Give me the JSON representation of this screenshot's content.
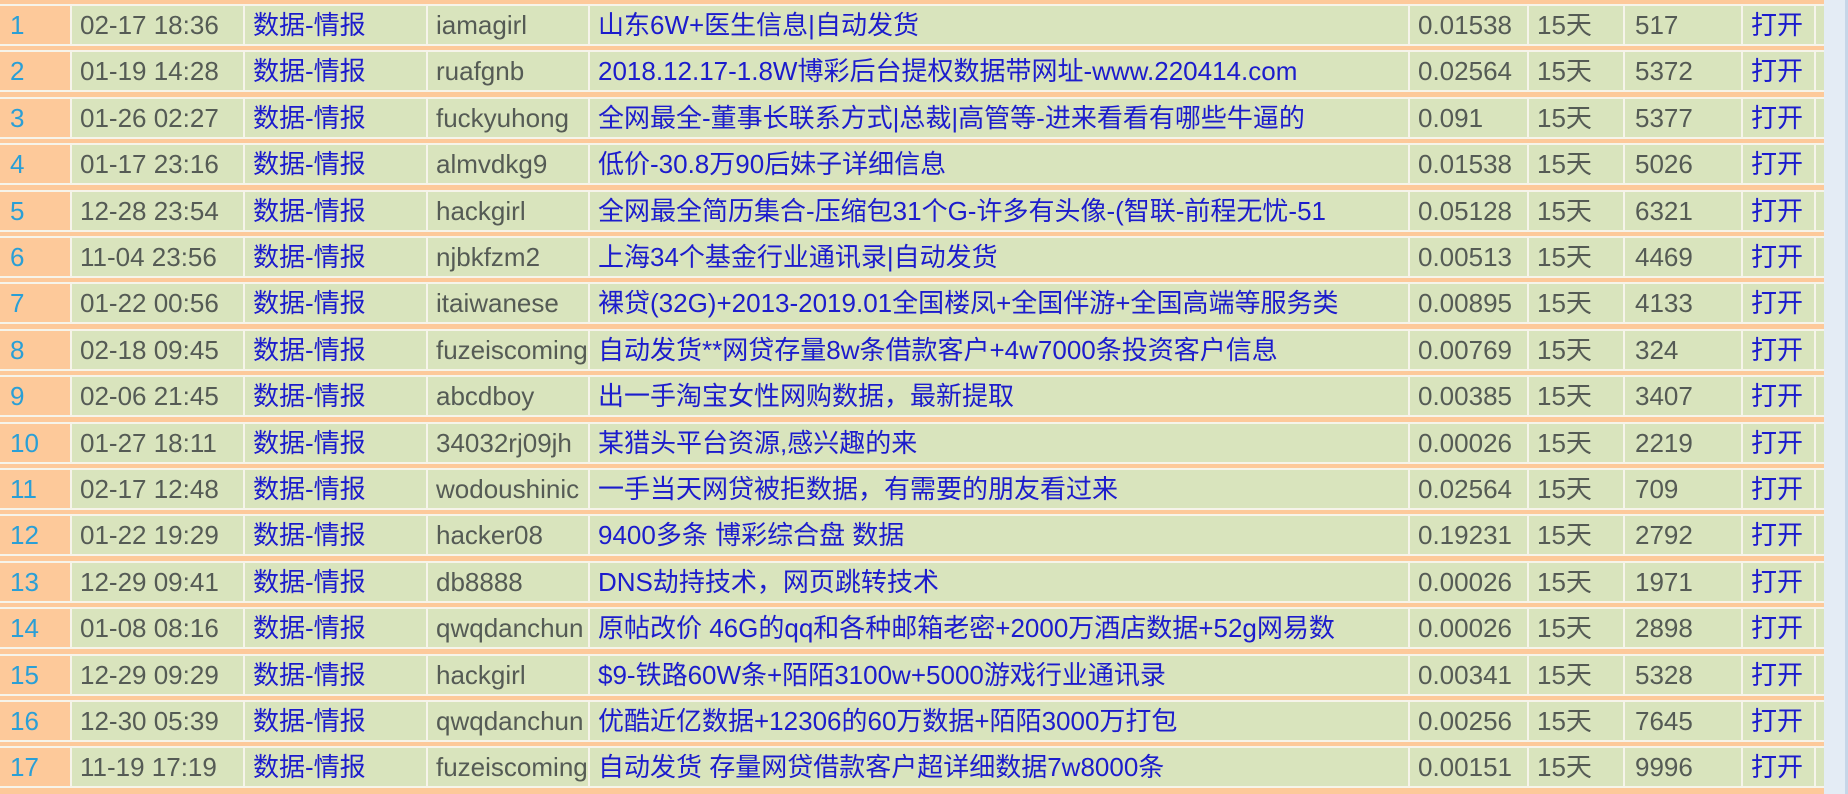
{
  "colors": {
    "row_separator": "#fdc99a",
    "cell_bg": "#d9e4bd",
    "index_bg": "#fdc99a",
    "index_text": "#2a9fd6",
    "link_text": "#1c1ccc",
    "plain_text": "#555b55",
    "page_bg": "#e4ecf5"
  },
  "rows": [
    {
      "index": "1",
      "date": "02-17 18:36",
      "category": "数据-情报",
      "user": "iamagirl",
      "title": "山东6W+医生信息|自动发货",
      "price": "0.01538",
      "days": "15天",
      "views": "517",
      "action": "打开"
    },
    {
      "index": "2",
      "date": "01-19 14:28",
      "category": "数据-情报",
      "user": "ruafgnb",
      "title": "2018.12.17-1.8W博彩后台提权数据带网址-www.220414.com",
      "price": "0.02564",
      "days": "15天",
      "views": "5372",
      "action": "打开"
    },
    {
      "index": "3",
      "date": "01-26 02:27",
      "category": "数据-情报",
      "user": "fuckyuhong",
      "title": "全网最全-董事长联系方式|总裁|高管等-进来看看有哪些牛逼的",
      "price": "0.091",
      "days": "15天",
      "views": "5377",
      "action": "打开"
    },
    {
      "index": "4",
      "date": "01-17 23:16",
      "category": "数据-情报",
      "user": "almvdkg9",
      "title": "低价-30.8万90后妹子详细信息",
      "price": "0.01538",
      "days": "15天",
      "views": "5026",
      "action": "打开"
    },
    {
      "index": "5",
      "date": "12-28 23:54",
      "category": "数据-情报",
      "user": "hackgirl",
      "title": "全网最全简历集合-压缩包31个G-许多有头像-(智联-前程无忧-51",
      "price": "0.05128",
      "days": "15天",
      "views": "6321",
      "action": "打开"
    },
    {
      "index": "6",
      "date": "11-04 23:56",
      "category": "数据-情报",
      "user": "njbkfzm2",
      "title": "上海34个基金行业通讯录|自动发货",
      "price": "0.00513",
      "days": "15天",
      "views": "4469",
      "action": "打开"
    },
    {
      "index": "7",
      "date": "01-22 00:56",
      "category": "数据-情报",
      "user": "itaiwanese",
      "title": "裸贷(32G)+2013-2019.01全国楼凤+全国伴游+全国高端等服务类",
      "price": "0.00895",
      "days": "15天",
      "views": "4133",
      "action": "打开"
    },
    {
      "index": "8",
      "date": "02-18 09:45",
      "category": "数据-情报",
      "user": "fuzeiscoming",
      "title": "自动发货**网贷存量8w条借款客户+4w7000条投资客户信息",
      "price": "0.00769",
      "days": "15天",
      "views": "324",
      "action": "打开"
    },
    {
      "index": "9",
      "date": "02-06 21:45",
      "category": "数据-情报",
      "user": "abcdboy",
      "title": "出一手淘宝女性网购数据，最新提取",
      "price": "0.00385",
      "days": "15天",
      "views": "3407",
      "action": "打开"
    },
    {
      "index": "10",
      "date": "01-27 18:11",
      "category": "数据-情报",
      "user": "34032rj09jh",
      "title": "某猎头平台资源,感兴趣的来",
      "price": "0.00026",
      "days": "15天",
      "views": "2219",
      "action": "打开"
    },
    {
      "index": "11",
      "date": "02-17 12:48",
      "category": "数据-情报",
      "user": "wodoushinic",
      "title": "一手当天网贷被拒数据，有需要的朋友看过来",
      "price": "0.02564",
      "days": "15天",
      "views": "709",
      "action": "打开"
    },
    {
      "index": "12",
      "date": "01-22 19:29",
      "category": "数据-情报",
      "user": "hacker08",
      "title": "9400多条 博彩综合盘 数据",
      "price": "0.19231",
      "days": "15天",
      "views": "2792",
      "action": "打开"
    },
    {
      "index": "13",
      "date": "12-29 09:41",
      "category": "数据-情报",
      "user": "db8888",
      "title": "DNS劫持技术，网页跳转技术",
      "price": "0.00026",
      "days": "15天",
      "views": "1971",
      "action": "打开"
    },
    {
      "index": "14",
      "date": "01-08 08:16",
      "category": "数据-情报",
      "user": "qwqdanchun",
      "title": "原帖改价 46G的qq和各种邮箱老密+2000万酒店数据+52g网易数",
      "price": "0.00026",
      "days": "15天",
      "views": "2898",
      "action": "打开"
    },
    {
      "index": "15",
      "date": "12-29 09:29",
      "category": "数据-情报",
      "user": "hackgirl",
      "title": "$9-铁路60W条+陌陌3100w+5000游戏行业通讯录",
      "price": "0.00341",
      "days": "15天",
      "views": "5328",
      "action": "打开"
    },
    {
      "index": "16",
      "date": "12-30 05:39",
      "category": "数据-情报",
      "user": "qwqdanchun",
      "title": "优酷近亿数据+12306的60万数据+陌陌3000万打包",
      "price": "0.00256",
      "days": "15天",
      "views": "7645",
      "action": "打开"
    },
    {
      "index": "17",
      "date": "11-19 17:19",
      "category": "数据-情报",
      "user": "fuzeiscoming",
      "title": "自动发货 存量网贷借款客户超详细数据7w8000条",
      "price": "0.00151",
      "days": "15天",
      "views": "9996",
      "action": "打开"
    }
  ]
}
